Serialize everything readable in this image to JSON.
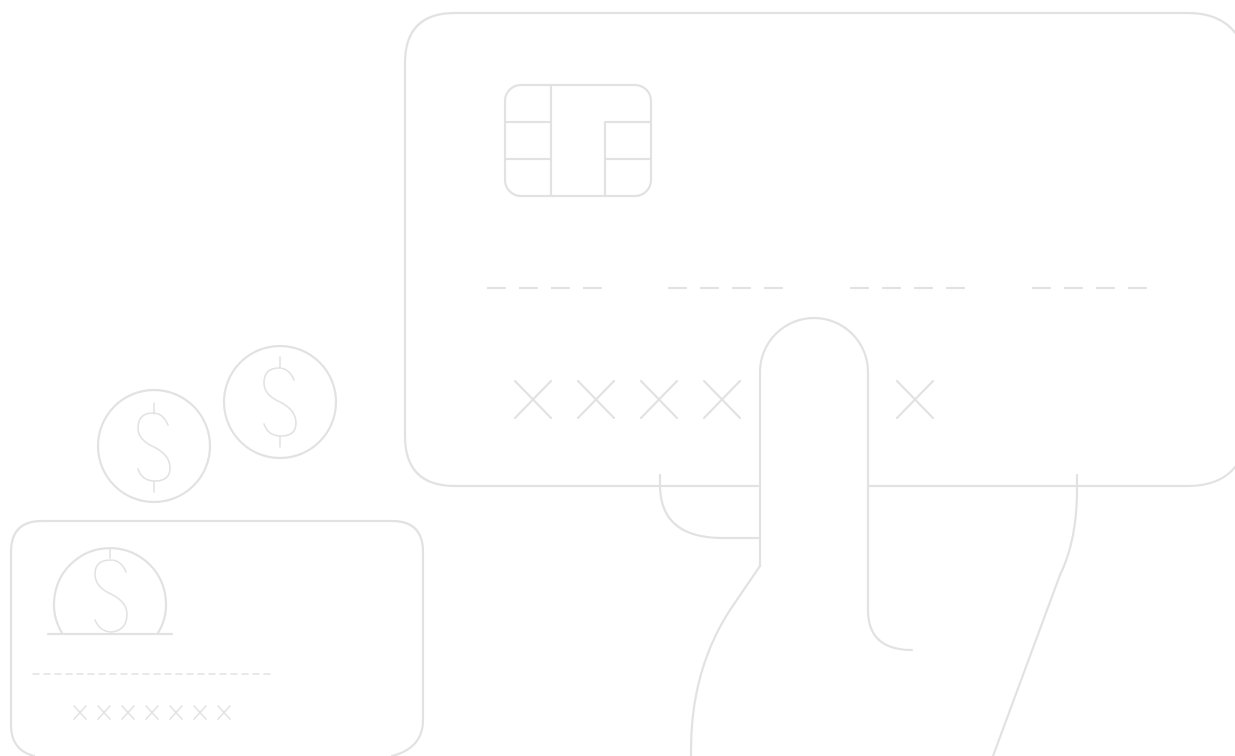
{
  "illustration": {
    "subject": "card-payment",
    "colors": {
      "line": "#e2e2e2",
      "background": "#ffffff"
    }
  }
}
